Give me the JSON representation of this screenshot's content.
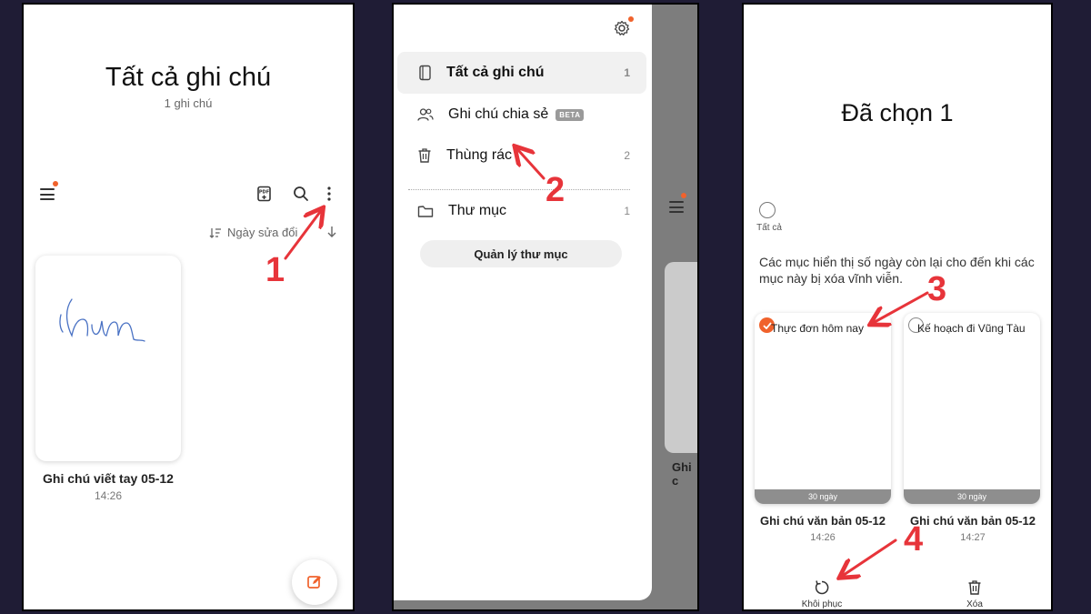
{
  "panel1": {
    "title": "Tất cả ghi chú",
    "count": "1 ghi chú",
    "sort_label": "Ngày sửa đổi",
    "note": {
      "title": "Ghi chú viết tay 05-12",
      "time": "14:26",
      "handwriting": "hm"
    },
    "icons": [
      "menu-icon",
      "pdf-import-icon",
      "search-icon",
      "more-vert-icon",
      "sort-icon",
      "arrow-down-icon",
      "compose-icon"
    ]
  },
  "panel2": {
    "menu": [
      {
        "label": "Tất cả ghi chú",
        "count": "1",
        "icon": "notebook-icon",
        "active": true
      },
      {
        "label": "Ghi chú chia sẻ",
        "badge": "BETA",
        "icon": "people-icon"
      },
      {
        "label": "Thùng rác",
        "count": "2",
        "icon": "trash-icon"
      },
      {
        "label": "Thư mục",
        "count": "1",
        "icon": "folder-icon"
      }
    ],
    "manage_button": "Quản lý thư mục",
    "peek_text": "Ghi c"
  },
  "panel3": {
    "title": "Đã chọn 1",
    "select_all_label": "Tất cả",
    "info_text": "Các mục hiển thị số ngày còn lại cho đến khi các mục này bị xóa vĩnh viễn.",
    "cards": [
      {
        "header": "Thực đơn hôm nay",
        "days": "30 ngày",
        "title": "Ghi chú văn bản 05-12",
        "time": "14:26",
        "selected": true
      },
      {
        "header": "Kế hoạch đi Vũng Tàu",
        "days": "30 ngày",
        "title": "Ghi chú văn bản 05-12",
        "time": "14:27",
        "selected": false
      }
    ],
    "actions": {
      "restore": "Khôi phục",
      "delete": "Xóa"
    }
  },
  "steps": [
    "1",
    "2",
    "3",
    "4"
  ],
  "colors": {
    "accent_orange": "#f0622c",
    "annotation_red": "#e7343a",
    "background": "#1f1c35"
  }
}
